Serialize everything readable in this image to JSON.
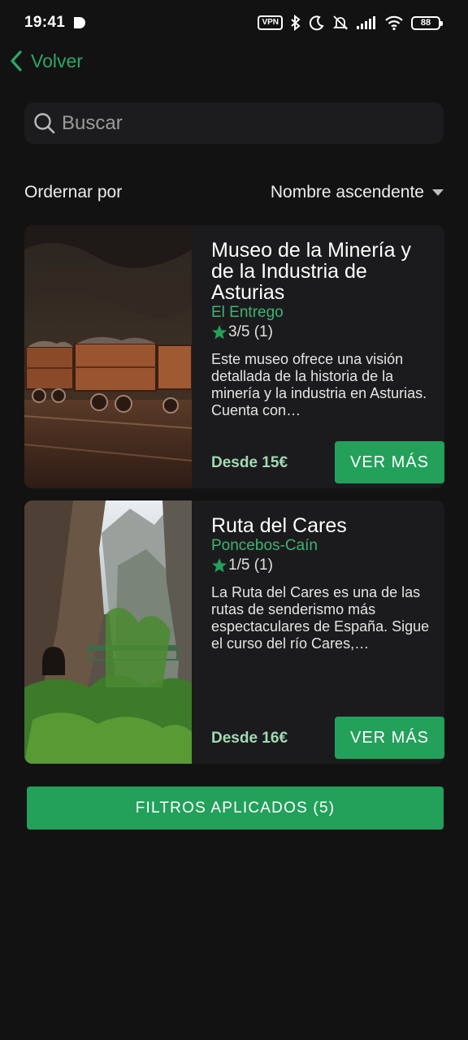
{
  "status_bar": {
    "time": "19:41",
    "vpn": "VPN",
    "battery": "88",
    "icons": [
      "play-icon",
      "bluetooth-icon",
      "moon-icon",
      "bell-off-icon",
      "signal-icon",
      "wifi-icon",
      "battery-icon"
    ]
  },
  "nav": {
    "back_label": "Volver",
    "back_icon": "chevron-left-icon"
  },
  "search": {
    "placeholder": "Buscar",
    "value": "",
    "icon": "search-icon"
  },
  "sort": {
    "label": "Ordernar por",
    "selected": "Nombre ascendente"
  },
  "results": [
    {
      "title": "Museo de la Minería y de la Industria de Asturias",
      "location": "El Entrego",
      "rating": "3/5 (1)",
      "description": "Este museo ofrece una visión detallada de la historia de la minería y la industria en Asturias. Cuenta con…",
      "price": "Desde 15€",
      "button": "VER MÁS",
      "image": "mine-carts-photo"
    },
    {
      "title": "Ruta del Cares",
      "location": "Poncebos-Caín",
      "rating": "1/5 (1)",
      "description": "La Ruta del Cares es una de las rutas de senderismo más espectaculares de España. Sigue el curso del río Cares,…",
      "price": "Desde 16€",
      "button": "VER MÁS",
      "image": "gorge-trail-photo"
    }
  ],
  "filters_button": "FILTROS APLICADOS (5)",
  "colors": {
    "background": "#121212",
    "card": "#1b1b1d",
    "accent": "#23a05a",
    "location": "#3db372",
    "price": "#a3d9b4"
  }
}
